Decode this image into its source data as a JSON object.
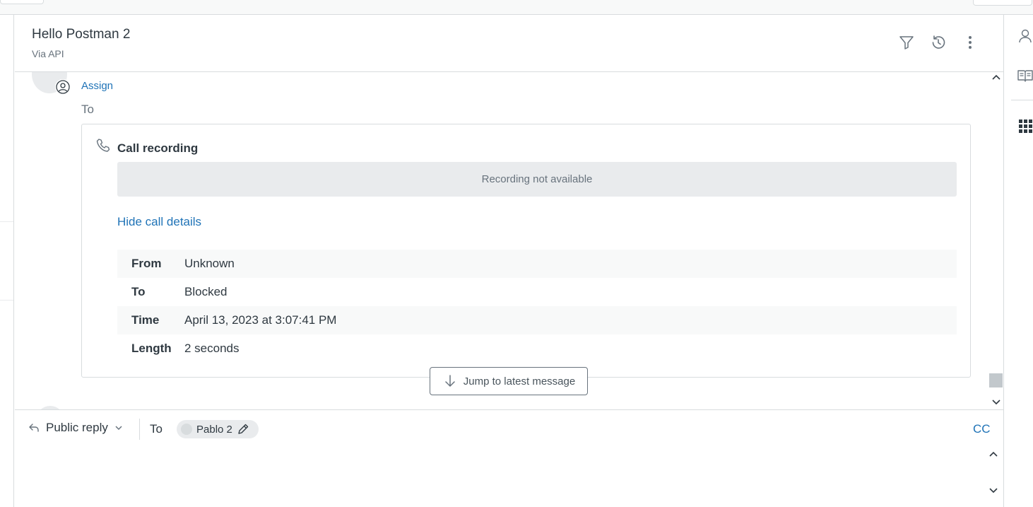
{
  "header": {
    "title": "Hello Postman 2",
    "subtitle": "Via API"
  },
  "conversation": {
    "assign_label": "Assign",
    "to_label": "To",
    "call_card": {
      "title": "Call recording",
      "recording_status": "Recording not available",
      "toggle_details_label": "Hide call details",
      "details": [
        {
          "key": "From",
          "value": "Unknown"
        },
        {
          "key": "To",
          "value": "Blocked"
        },
        {
          "key": "Time",
          "value": "April 13, 2023 at 3:07:41 PM"
        },
        {
          "key": "Length",
          "value": "2 seconds"
        }
      ]
    },
    "jump_button_label": "Jump to latest message"
  },
  "reply": {
    "type_label": "Public reply",
    "to_label": "To",
    "recipient": "Pablo 2",
    "cc_label": "CC"
  },
  "colors": {
    "link": "#1f73b7",
    "text": "#2f3941",
    "muted": "#68737d",
    "border": "#d8dcde"
  }
}
